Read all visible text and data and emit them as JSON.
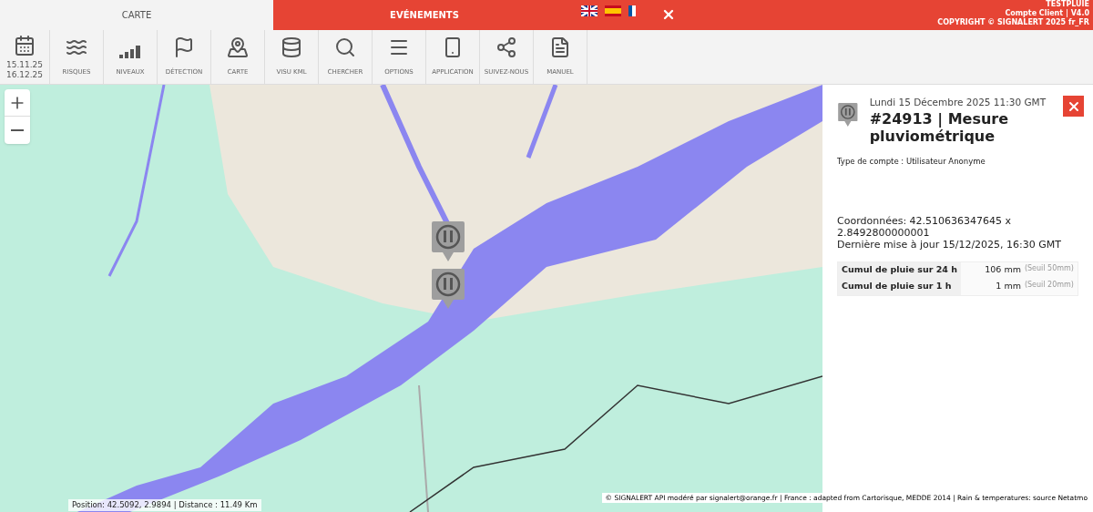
{
  "top_tabs": [
    {
      "label": "CARTE",
      "selected": false
    },
    {
      "label": "EVÉNEMENTS",
      "selected": true
    }
  ],
  "header_info": [
    "TESTPLUIE",
    "Compte Client | V4.0",
    "COPYRIGHT © SIGNALERT 2025 fr_FR"
  ],
  "toolbar": {
    "dates": [
      "15.11.25",
      "16.12.25"
    ],
    "items": [
      {
        "label": "RISQUES",
        "kind": "risk"
      },
      {
        "label": "NIVEAUX",
        "kind": "levels"
      },
      {
        "label": "DÉTECTION",
        "kind": "flag"
      },
      {
        "label": "CARTE",
        "kind": "map"
      },
      {
        "label": "VISU KML",
        "kind": "database"
      },
      {
        "label": "CHERCHER",
        "kind": "search"
      },
      {
        "label": "OPTIONS",
        "kind": "menu"
      },
      {
        "label": "APPLICATION",
        "kind": "phone"
      },
      {
        "label": "SUIVEZ-NOUS",
        "kind": "share"
      },
      {
        "label": "MANUEL",
        "kind": "manual"
      }
    ]
  },
  "map": {
    "position": "Position: 42.5092, 2.9894 | Distance : 11.49 Km",
    "attribution": "© SIGNALERT API modéré par signalert@orange.fr | France : adapted from Cartorisque, MEDDE 2014 | Rain & temperatures: source Netatmo"
  },
  "panel": {
    "date": "Lundi 15 Décembre 2025 11:30 GMT",
    "title": "#24913 | Mesure pluviométrique",
    "account_type": "Type de compte : Utilisateur Anonyme",
    "coordinates": "Coordonnées: 42.510636347645 x 2.8492800000001",
    "last_update": "Dernière mise à jour 15/12/2025, 16:30 GMT",
    "measures": [
      {
        "label": "Cumul de pluie sur 24 h",
        "value": "106 mm",
        "threshold": "(Seuil 50mm)"
      },
      {
        "label": "Cumul de pluie sur 1 h",
        "value": "1 mm",
        "threshold": "(Seuil 20mm)"
      }
    ]
  }
}
